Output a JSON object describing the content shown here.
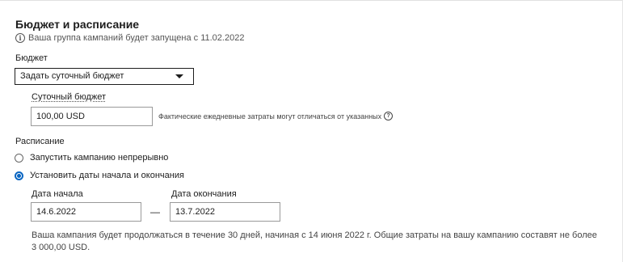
{
  "section": {
    "title": "Бюджет и расписание",
    "info_icon": "info-icon",
    "info_text": "Ваша группа кампаний будет запущена с 11.02.2022"
  },
  "budget": {
    "label": "Бюджет",
    "select_value": "Задать суточный бюджет",
    "daily_label": "Суточный бюджет",
    "daily_value": "100,00 USD",
    "hint": "Фактические ежедневные затраты могут отличаться от указанных",
    "hint_icon": "help-icon"
  },
  "schedule": {
    "label": "Расписание",
    "options": [
      {
        "label": "Запустить кампанию непрерывно",
        "selected": false
      },
      {
        "label": "Установить даты начала и окончания",
        "selected": true
      }
    ],
    "start_label": "Дата начала",
    "start_value": "14.6.2022",
    "separator": "—",
    "end_label": "Дата окончания",
    "end_value": "13.7.2022",
    "summary": "Ваша кампания будет продолжаться в течение 30 дней, начиная с 14 июня 2022 г. Общие затраты на вашу кампанию составят не более 3 000,00 USD."
  },
  "colors": {
    "accent": "#0a66c2",
    "text": "#1d1d1d",
    "muted": "#555555"
  }
}
